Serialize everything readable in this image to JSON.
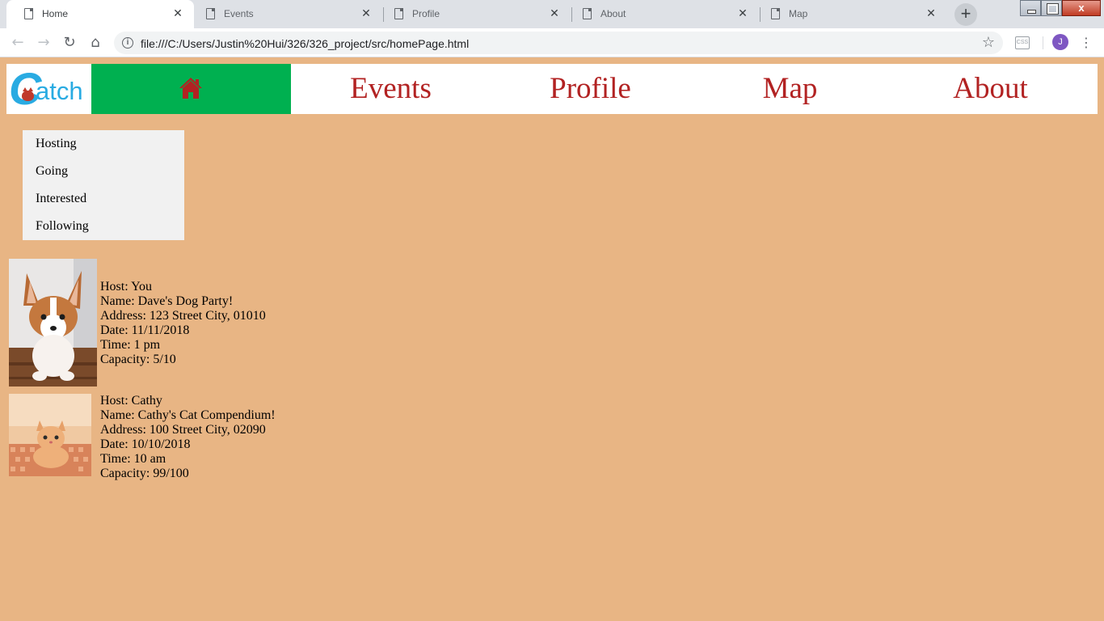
{
  "browser": {
    "tabs": [
      {
        "title": "Home",
        "active": true
      },
      {
        "title": "Events",
        "active": false
      },
      {
        "title": "Profile",
        "active": false
      },
      {
        "title": "About",
        "active": false
      },
      {
        "title": "Map",
        "active": false
      }
    ],
    "tab_close_glyph": "✕",
    "new_tab_glyph": "+",
    "window_close_glyph": "x",
    "url": "file:///C:/Users/Justin%20Hui/326/326_project/src/homePage.html",
    "info_glyph": "i",
    "star_glyph": "☆",
    "back_glyph": "←",
    "forward_glyph": "→",
    "reload_glyph": "↻",
    "home_glyph": "⌂",
    "ext_glyph": "CSS",
    "avatar_initial": "J",
    "menu_glyph": "⋮"
  },
  "logo": {
    "big_letter": "C",
    "rest": "atch"
  },
  "nav": {
    "items": [
      {
        "label": "Events"
      },
      {
        "label": "Profile"
      },
      {
        "label": "Map"
      },
      {
        "label": "About"
      }
    ],
    "home_icon": "home-icon",
    "home_color": "#00b050",
    "link_color": "#b22222"
  },
  "submenu": {
    "items": [
      "Hosting",
      "Going",
      "Interested",
      "Following"
    ]
  },
  "events": [
    {
      "image": "corgi-puppy",
      "host": "Host: You",
      "name": "Name: Dave's Dog Party!",
      "address": "Address: 123 Street City, 01010",
      "date": "Date: 11/11/2018",
      "time": "Time: 1 pm",
      "capacity": "Capacity: 5/10"
    },
    {
      "image": "orange-kitten",
      "host": "Host: Cathy",
      "name": "Name: Cathy's Cat Compendium!",
      "address": "Address: 100 Street City, 02090",
      "date": "Date: 10/10/2018",
      "time": "Time: 10 am",
      "capacity": "Capacity: 99/100"
    }
  ],
  "colors": {
    "page_background": "#e8b584",
    "logo_blue": "#29abe2"
  }
}
